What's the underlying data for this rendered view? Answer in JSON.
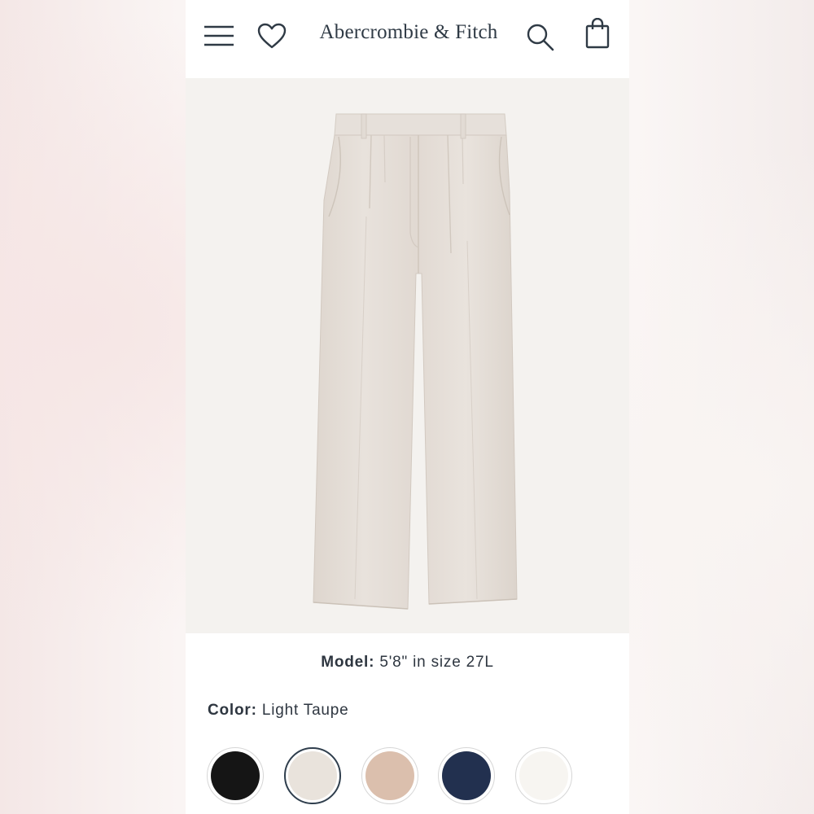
{
  "header": {
    "logo_text": "Abercrombie & Fitch",
    "icons": [
      "menu-icon",
      "heart-icon",
      "search-icon",
      "shopping-bag-icon"
    ]
  },
  "product": {
    "image_alt": "pleated wide leg trousers",
    "model_label": "Model:",
    "model_value": "5'8\" in size 27L",
    "color_label": "Color:",
    "color_value": "Light Taupe"
  },
  "swatches": [
    {
      "color": "#151515",
      "selected": false
    },
    {
      "color": "#e9e3dc",
      "selected": true
    },
    {
      "color": "#dbbfad",
      "selected": false
    },
    {
      "color": "#22304f",
      "selected": false
    },
    {
      "color": "#f7f5f1",
      "selected": false
    }
  ],
  "colors": {
    "text": "#2e3640",
    "product_fabric": "#e4ddd6",
    "image_background": "#f4f2ef"
  }
}
